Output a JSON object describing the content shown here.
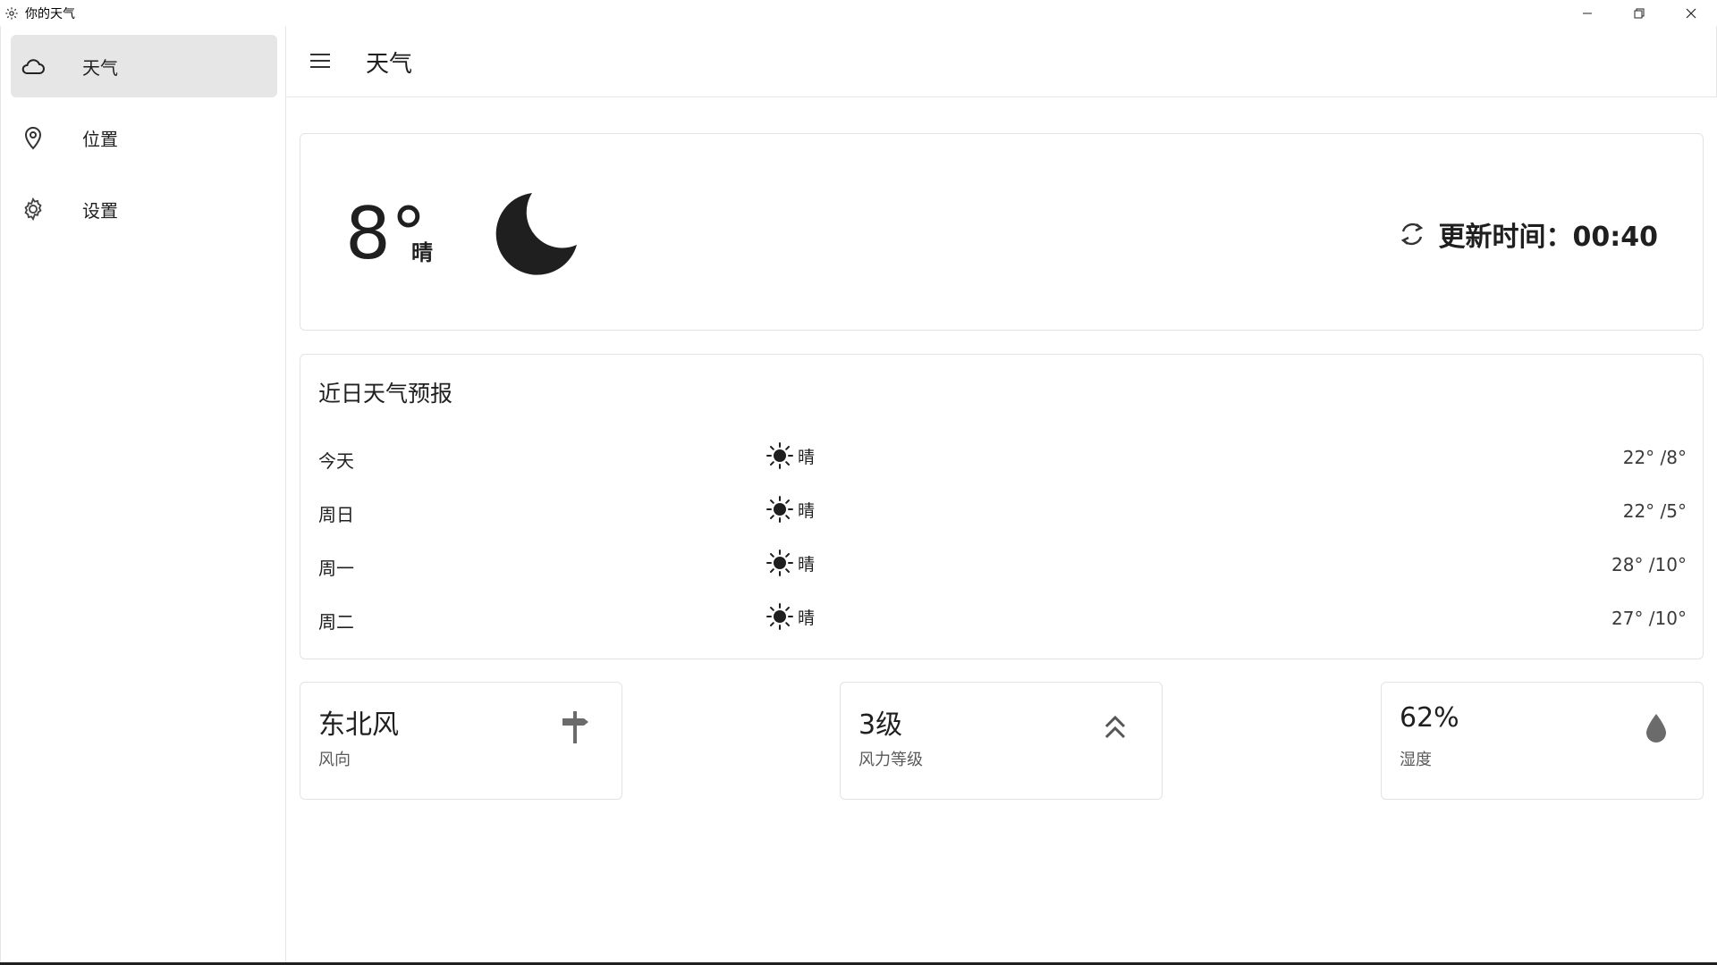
{
  "window": {
    "title": "你的天气",
    "icon": "gear-icon",
    "controls": [
      "minimize-icon",
      "restore-icon",
      "close-icon"
    ]
  },
  "sidebar": {
    "items": [
      {
        "label": "天气",
        "icon": "cloud-icon",
        "active": true
      },
      {
        "label": "位置",
        "icon": "location-pin-icon",
        "active": false
      },
      {
        "label": "设置",
        "icon": "gear-icon",
        "active": false
      }
    ]
  },
  "header": {
    "menu_icon": "hamburger-menu-icon",
    "title": "天气"
  },
  "current": {
    "temperature": "8°",
    "condition": "晴",
    "condition_icon": "moon-icon",
    "refresh_icon": "refresh-icon",
    "update_text": "更新时间：00:40"
  },
  "forecast": {
    "title": "近日天气预报",
    "rows": [
      {
        "day": "今天",
        "condition": "晴",
        "icon": "sun-icon",
        "temps": "22° /8°"
      },
      {
        "day": "周日",
        "condition": "晴",
        "icon": "sun-icon",
        "temps": "22° /5°"
      },
      {
        "day": "周一",
        "condition": "晴",
        "icon": "sun-icon",
        "temps": "28° /10°"
      },
      {
        "day": "周二",
        "condition": "晴",
        "icon": "sun-icon",
        "temps": "27° /10°"
      }
    ]
  },
  "details": [
    {
      "value": "东北风",
      "label": "风向",
      "icon": "signpost-icon"
    },
    {
      "value": "3级",
      "label": "风力等级",
      "icon": "double-chevron-up-icon"
    },
    {
      "value": "62%",
      "label": "湿度",
      "icon": "water-drop-icon"
    }
  ],
  "colors": {
    "text": "#1f1f1f",
    "active_nav": "#e6e6e6",
    "border": "#e3e3e3",
    "icon_gray": "#6b6b6b"
  }
}
